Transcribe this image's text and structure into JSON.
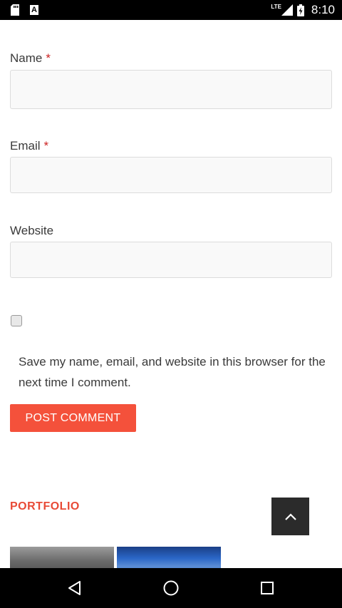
{
  "status_bar": {
    "network_label": "LTE",
    "time": "8:10"
  },
  "comment_form": {
    "name_label": "Name",
    "email_label": "Email",
    "website_label": "Website",
    "required_marker": "*",
    "name_value": "",
    "email_value": "",
    "website_value": "",
    "consent_checked": false,
    "consent_text": "Save my name, email, and website in this browser for the next time I comment.",
    "submit_label": "POST COMMENT"
  },
  "portfolio": {
    "heading": "PORTFOLIO"
  },
  "colors": {
    "accent": "#f4513b",
    "heading_accent": "#e84a36",
    "required": "#cc2222"
  },
  "icons": {
    "scroll_top": "chevron-up-icon",
    "nav_back": "back-triangle-icon",
    "nav_home": "home-circle-icon",
    "nav_recents": "recents-square-icon"
  }
}
